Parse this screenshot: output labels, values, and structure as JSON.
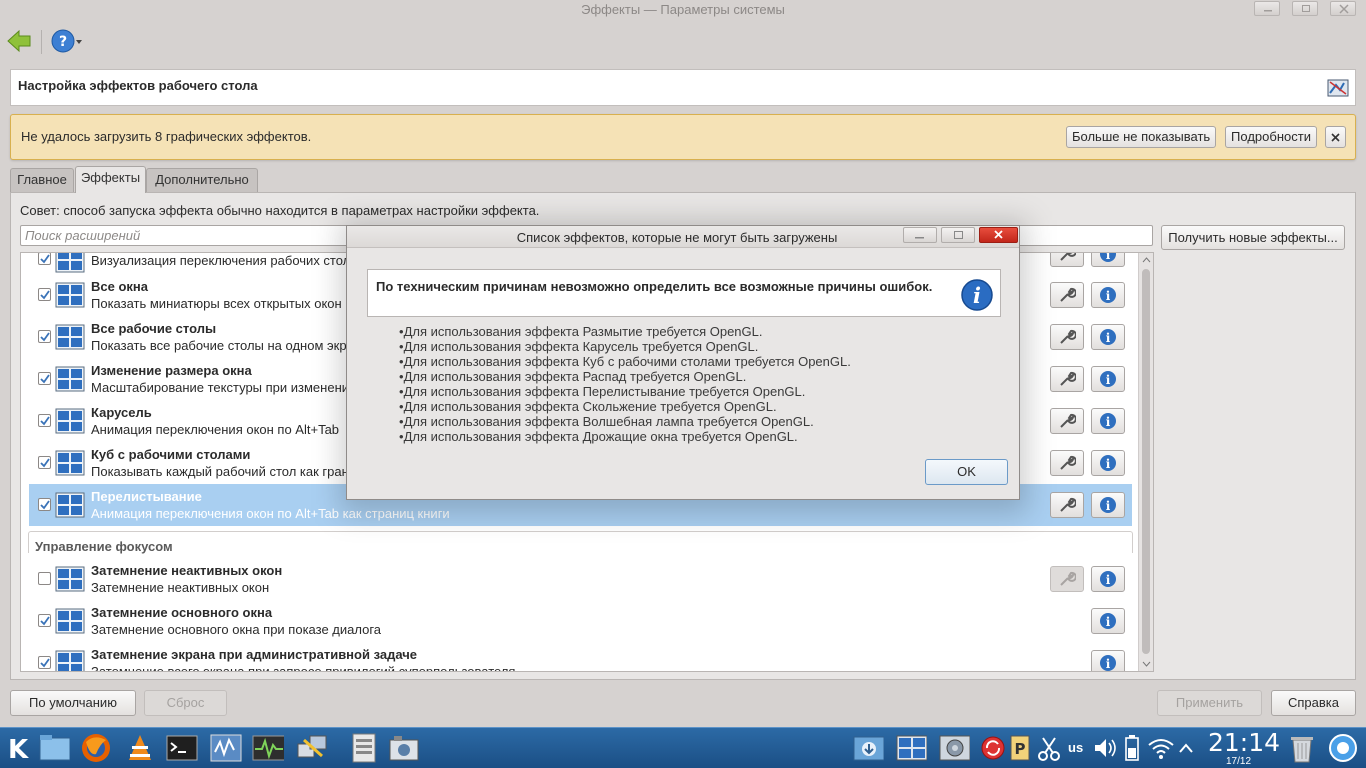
{
  "window": {
    "title": "Эффекты — Параметры системы"
  },
  "panel": {
    "title": "Настройка эффектов рабочего стола"
  },
  "warning": {
    "text": "Не удалось загрузить 8 графических эффектов.",
    "dont_show": "Больше не показывать",
    "details": "Подробности"
  },
  "tabs": [
    "Главное",
    "Эффекты",
    "Дополнительно"
  ],
  "hint": "Совет: способ запуска эффекта обычно находится в параметрах настройки эффекта.",
  "search": {
    "placeholder": "Поиск расширений"
  },
  "get_new": "Получить новые эффекты...",
  "effects": [
    {
      "name": "Визуализация переключения рабочих столов",
      "desc": "",
      "checked": true
    },
    {
      "name": "Все окна",
      "desc": "Показать миниатюры всех открытых окон",
      "checked": true
    },
    {
      "name": "Все рабочие столы",
      "desc": "Показать все рабочие столы на одном экране",
      "checked": true
    },
    {
      "name": "Изменение размера окна",
      "desc": "Масштабирование текстуры при изменении размера",
      "checked": true
    },
    {
      "name": "Карусель",
      "desc": "Анимация переключения окон по Alt+Tab",
      "checked": true
    },
    {
      "name": "Куб с рабочими столами",
      "desc": "Показывать каждый рабочий стол как грань куба",
      "checked": true
    },
    {
      "name": "Перелистывание",
      "desc": "Анимация переключения окон по Alt+Tab как страниц книги",
      "checked": true
    }
  ],
  "focus_group": {
    "title": "Управление фокусом",
    "effects": [
      {
        "name": "Затемнение неактивных окон",
        "desc": "Затемнение неактивных окон",
        "checked": false
      },
      {
        "name": "Затемнение основного окна",
        "desc": "Затемнение основного окна при показе диалога",
        "checked": true
      },
      {
        "name": "Затемнение экрана при административной задаче",
        "desc": "Затемнение всего экрана при запросе привилегий суперпользователя",
        "checked": true
      }
    ]
  },
  "dialog": {
    "title": "Список эффектов, которые не могут быть загружены",
    "message": "По техническим причинам невозможно определить все возможные причины ошибок.",
    "errors": [
      "Для использования эффекта Размытие требуется OpenGL.",
      "Для использования эффекта Карусель требуется OpenGL.",
      "Для использования эффекта Куб с рабочими столами требуется OpenGL.",
      "Для использования эффекта Распад требуется OpenGL.",
      "Для использования эффекта Перелистывание требуется OpenGL.",
      "Для использования эффекта Скольжение требуется OpenGL.",
      "Для использования эффекта Волшебная лампа требуется OpenGL.",
      "Для использования эффекта Дрожащие окна требуется OpenGL."
    ],
    "ok": "OK"
  },
  "buttons": {
    "defaults": "По умолчанию",
    "reset": "Сброс",
    "apply": "Применить",
    "help": "Справка"
  },
  "taskbar": {
    "layout": "us",
    "time": "21:14",
    "date": "17/12"
  }
}
